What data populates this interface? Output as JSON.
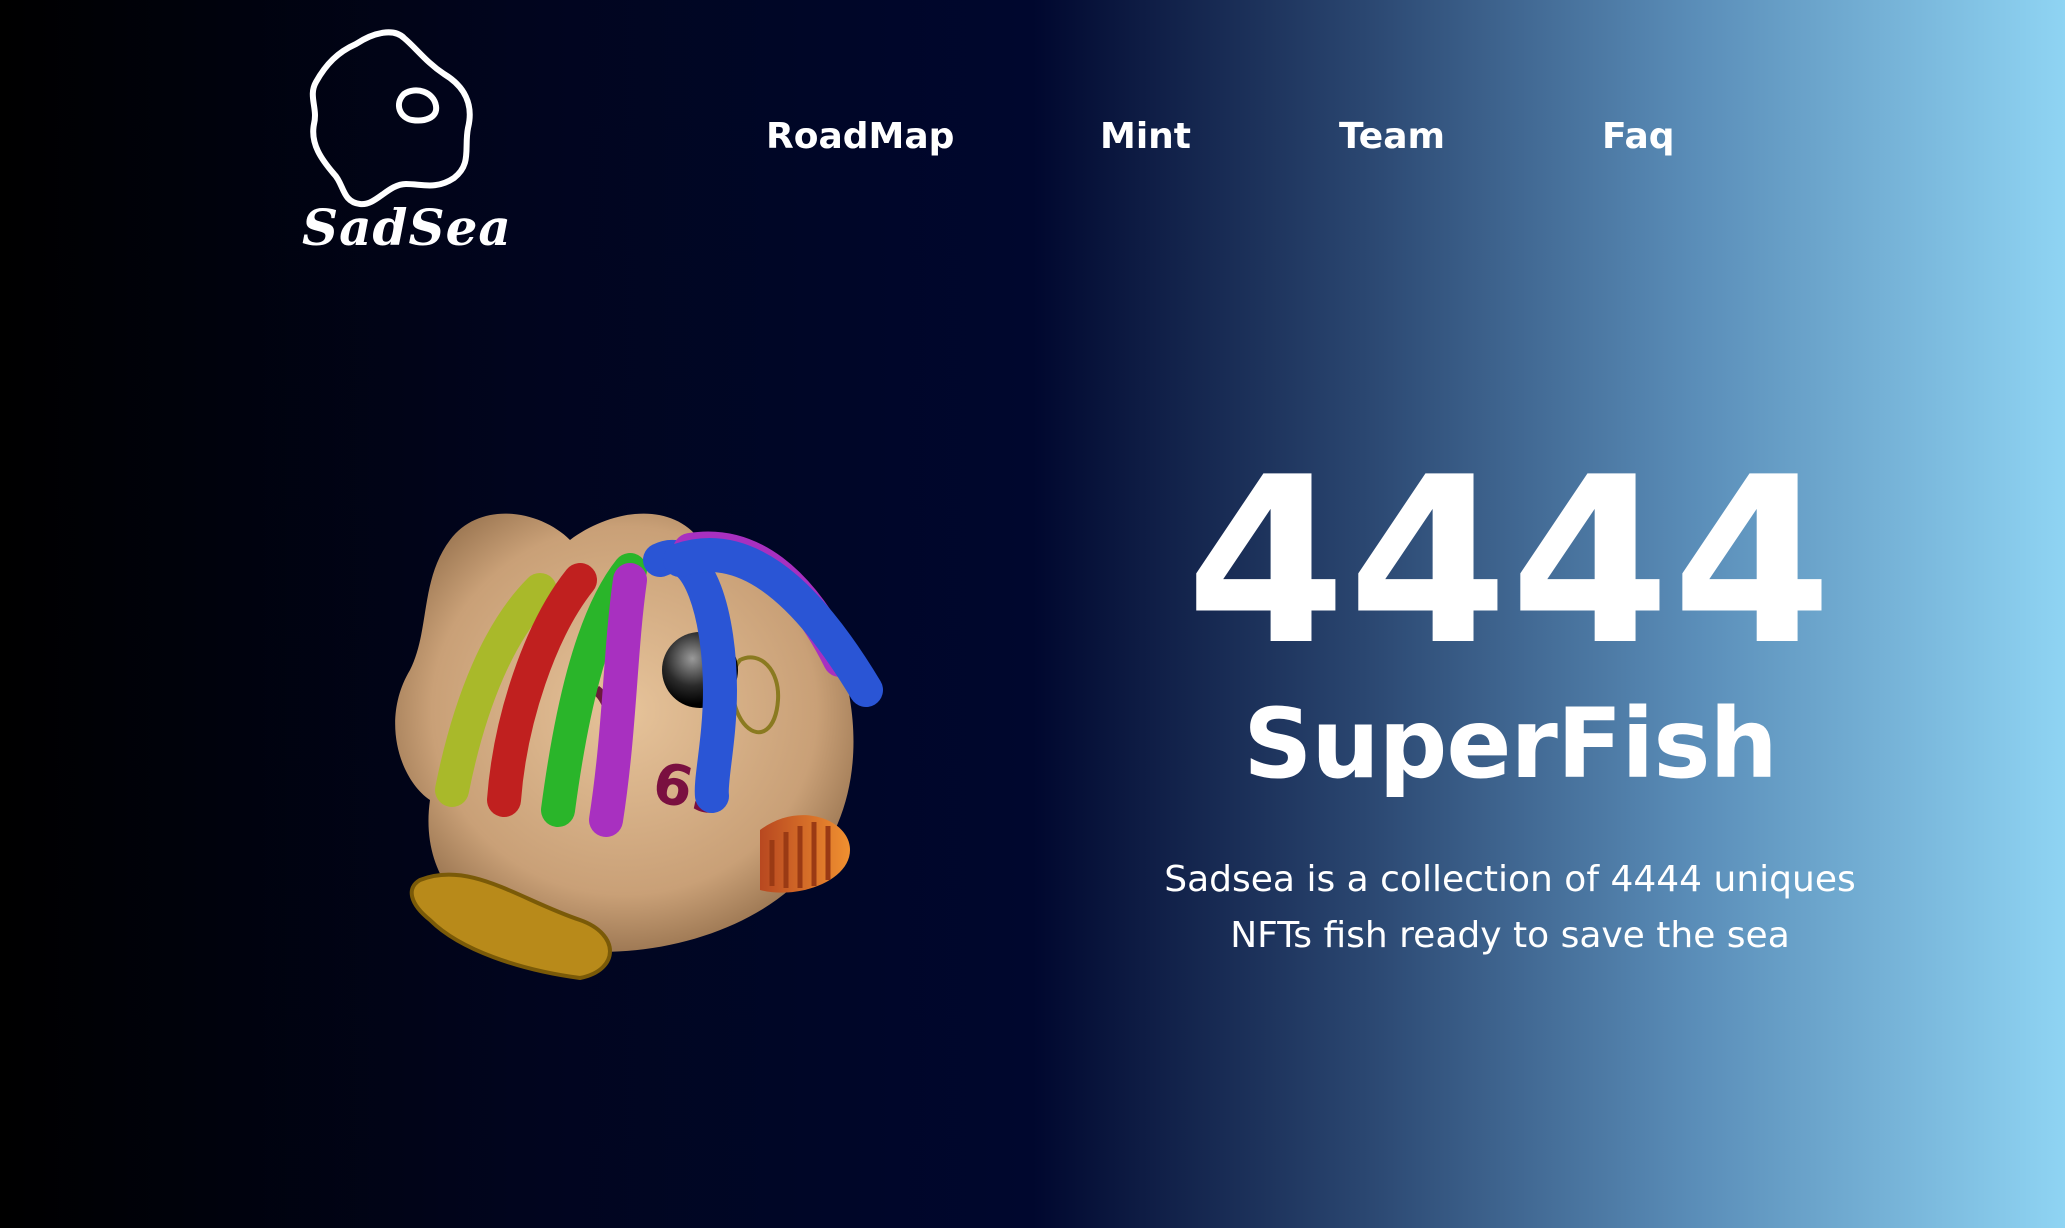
{
  "brand": {
    "name": "SadSea",
    "logo_icon": "sadsea-blob-logo-icon"
  },
  "nav": {
    "items": [
      {
        "label": "RoadMap"
      },
      {
        "label": "Mint"
      },
      {
        "label": "Team"
      },
      {
        "label": "Faq"
      }
    ]
  },
  "hero": {
    "count": "4444",
    "title": "SuperFish",
    "description_line1": "Sadsea is a collection of 4444 uniques",
    "description_line2": "NFTs fish ready to save the sea",
    "image_icon": "fish-nft-character-icon"
  },
  "colors": {
    "background_left": "#000000",
    "background_mid": "#00072e",
    "background_right": "#8fd4f3",
    "text": "#ffffff"
  }
}
